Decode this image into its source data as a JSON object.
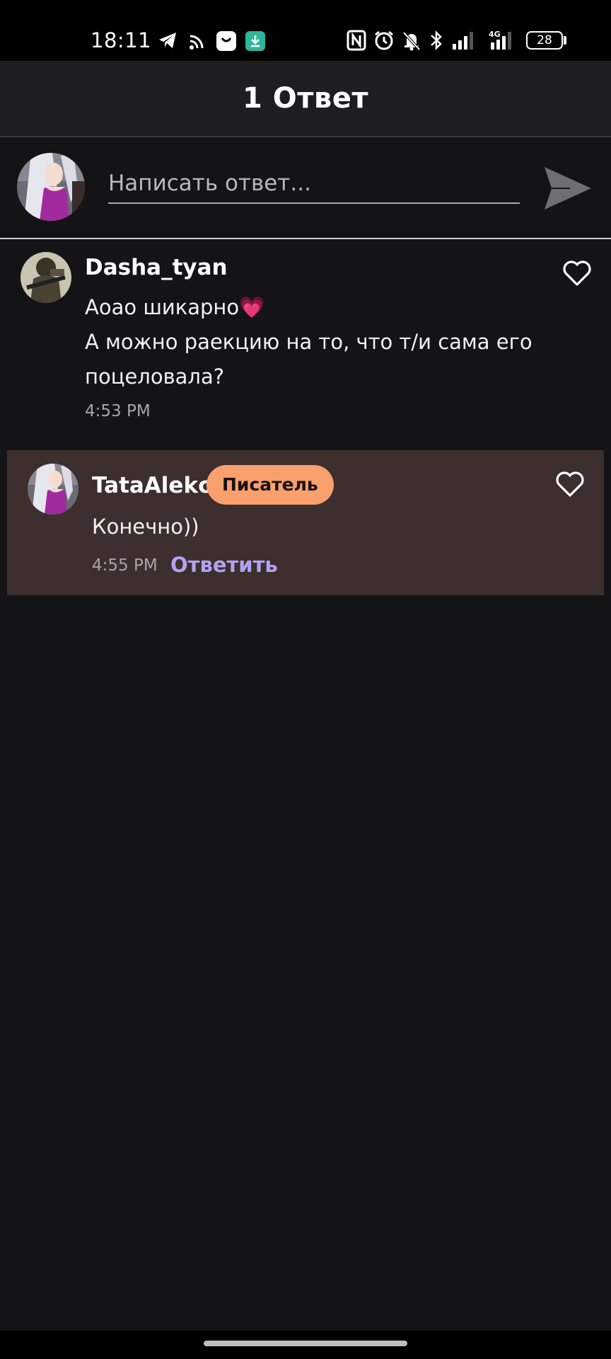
{
  "status_bar": {
    "time": "18:11",
    "battery": "28",
    "network_label": "4G",
    "icons": [
      "telegram-icon",
      "cast-icon",
      "app-icon",
      "download-icon",
      "nfc-icon",
      "alarm-icon",
      "mute-icon",
      "bluetooth-icon",
      "signal-icon",
      "signal-4g-icon",
      "battery-icon"
    ]
  },
  "header": {
    "title": "1 Ответ"
  },
  "compose": {
    "placeholder": "Написать ответ..."
  },
  "comments": [
    {
      "username": "Dasha_tyan",
      "line1": "Аоао шикарно",
      "emoji": "💗",
      "line2": "А можно раекцию на то, что т/и сама его",
      "line3": "поцеловала?",
      "time": "4:53 PM"
    },
    {
      "username": "TataAlekc",
      "badge": "Писатель",
      "text": "Конечно))",
      "time": "4:55 PM",
      "reply_label": "Ответить"
    }
  ],
  "colors": {
    "background": "#141316",
    "header": "#1e1d20",
    "highlight_card": "#3d2f2d",
    "badge": "#f9a06e",
    "reply_link": "#b3a1f2"
  }
}
